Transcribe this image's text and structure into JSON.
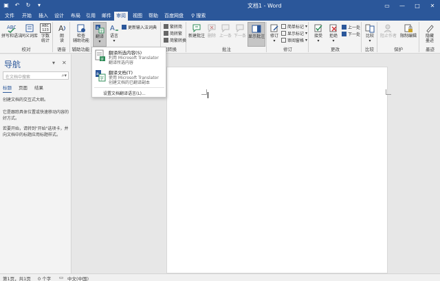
{
  "window": {
    "title": "文档1 - Word",
    "qat": [
      "save-icon",
      "undo-icon",
      "redo-icon",
      "customize-icon"
    ],
    "controls": [
      "ribbon-options-icon",
      "minimize-icon",
      "maximize-icon",
      "close-icon"
    ]
  },
  "tabs": [
    {
      "label": "文件"
    },
    {
      "label": "开始"
    },
    {
      "label": "插入"
    },
    {
      "label": "设计"
    },
    {
      "label": "布局"
    },
    {
      "label": "引用"
    },
    {
      "label": "邮件"
    },
    {
      "label": "审阅"
    },
    {
      "label": "视图"
    },
    {
      "label": "帮助"
    },
    {
      "label": "百度网盘"
    }
  ],
  "tellme": {
    "icon": "lightbulb-icon",
    "label": "搜索"
  },
  "ribbon": {
    "proofing": {
      "label": "校对",
      "spell": "拼写和语法",
      "thesaurus": "同义词库",
      "wordcount_top": "ABC",
      "wordcount_num": "123",
      "wordcount": "字数\n统计"
    },
    "speech": {
      "label": "语音",
      "read": "朗\n读"
    },
    "accessibility": {
      "label": "辅助功能",
      "check": "检查\n辅助功能"
    },
    "language": {
      "label": "语言",
      "translate": "翻译",
      "lang": "语言",
      "update_ime": "更新输入法词典"
    },
    "chinese": {
      "label": "中文简繁转换",
      "to_trad": "繁转简",
      "to_simp": "简转繁",
      "convert": "简繁转换"
    },
    "comments": {
      "label": "批注",
      "new": "新建批注",
      "delete": "删除",
      "prev": "上一条",
      "next": "下一条",
      "show": "显示批注"
    },
    "tracking": {
      "label": "修订",
      "track": "修订",
      "simple_markup": "简单标记",
      "show_markup": "显示标记",
      "review_pane": "审阅窗格"
    },
    "changes": {
      "label": "更改",
      "accept": "接受",
      "reject": "拒绝",
      "prev": "上一处",
      "next": "下一处"
    },
    "compare": {
      "label": "比较",
      "compare": "比较"
    },
    "protect": {
      "label": "保护",
      "block": "阻止作者",
      "restrict": "限制编辑"
    },
    "ink": {
      "label": "墨迹",
      "hide": "隐藏\n墨迹"
    }
  },
  "translate_menu": {
    "selection_title": "翻译所选内容(S)",
    "selection_sub1": "利用 Microsoft Translator",
    "selection_sub2": "翻译所选内容",
    "document_title": "翻译文档(T)",
    "document_sub1": "使用 Microsoft Translator",
    "document_sub2": "创建文档的已翻译副本",
    "settings": "设置文档翻译语言(L)..."
  },
  "navpane": {
    "title": "导航",
    "search_placeholder": "在文档中搜索",
    "tabs": [
      "标题",
      "页面",
      "结果"
    ],
    "para1": "创建文档的交互式大纲。",
    "para2": "它是跟踪具体位置或快速移动内容的好方式。",
    "para3": "若要开始，请转到\"开始\"选项卡，并向文档中的标题应用标题样式。"
  },
  "status": {
    "page": "第1页，共1页",
    "words": "0 个字",
    "lang": "中文(中国)"
  },
  "colors": {
    "accent": "#2b579a"
  }
}
